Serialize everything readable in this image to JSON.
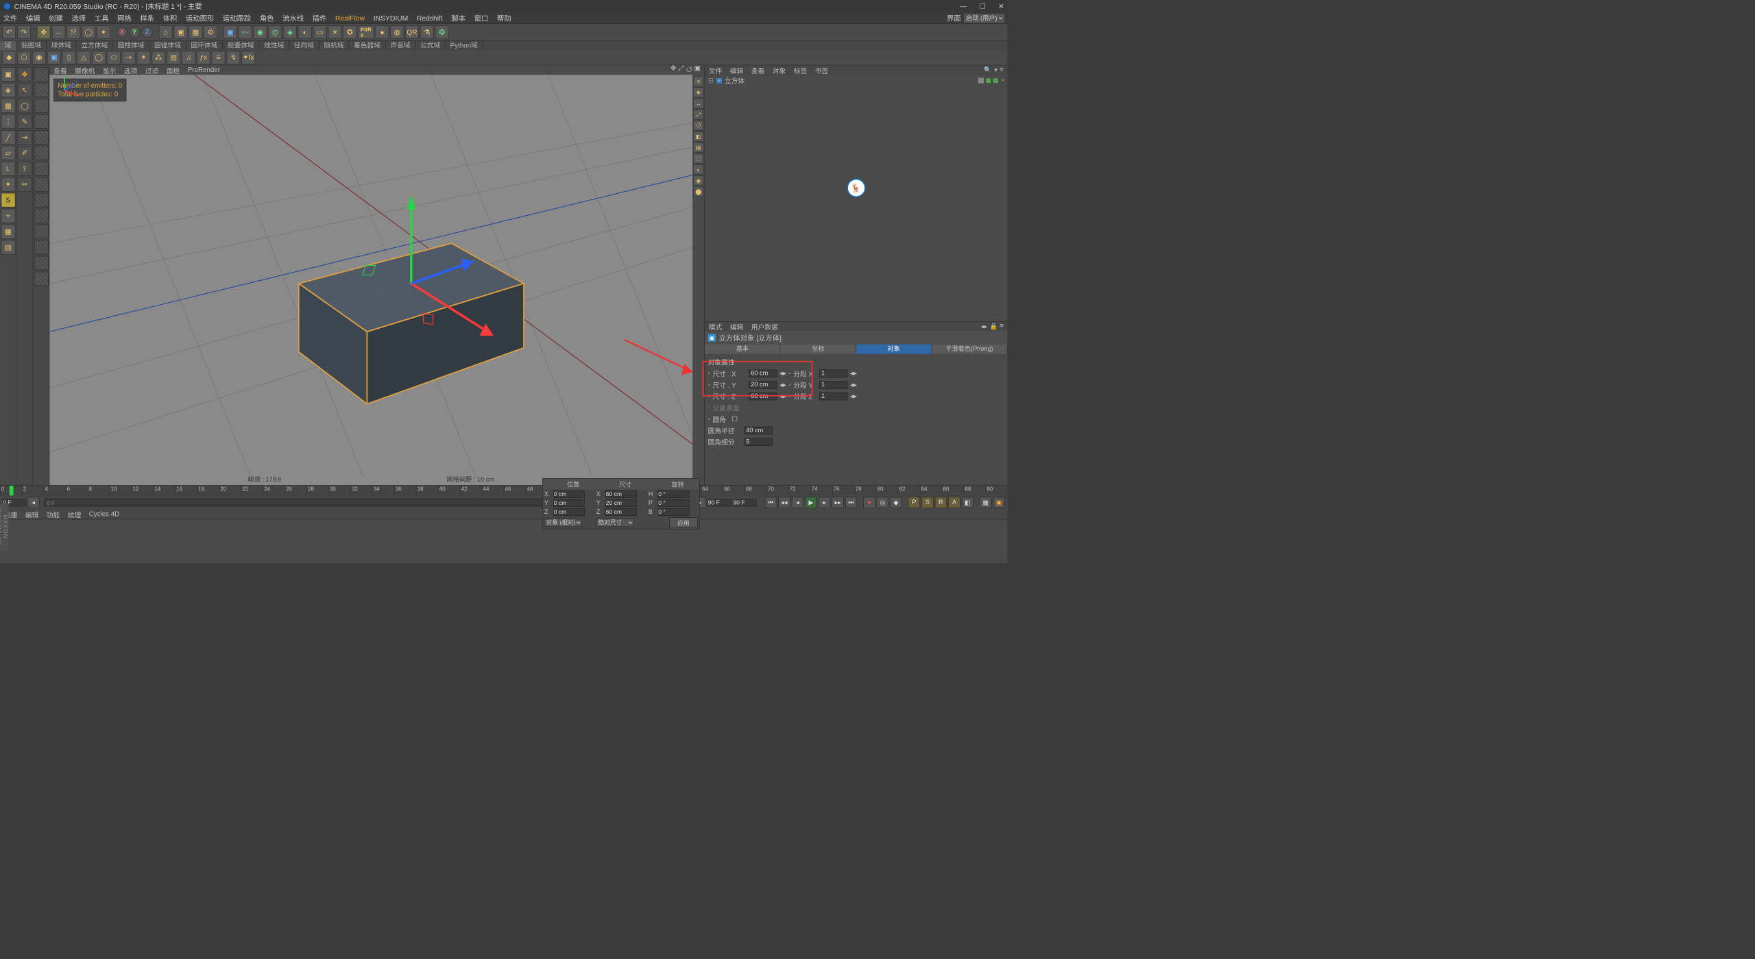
{
  "window": {
    "title": "CINEMA 4D R20.059 Studio (RC - R20) - [未标题 1 *] - 主要"
  },
  "mainmenu": {
    "items": [
      "文件",
      "编辑",
      "创建",
      "选择",
      "工具",
      "网格",
      "样条",
      "体积",
      "运动图形",
      "运动跟踪",
      "角色",
      "流水线",
      "插件",
      "RealFlow",
      "INSYDIUM",
      "Redshift",
      "脚本",
      "窗口",
      "帮助"
    ],
    "hl_idx": 13,
    "layout_lbl": "界面",
    "layout_val": "启动 (用户)"
  },
  "tabstrip": {
    "tabs": [
      "域",
      "贴图域",
      "球体域",
      "立方体域",
      "圆柱体域",
      "圆锥体域",
      "圆环体域",
      "胶囊体域",
      "线性域",
      "径向域",
      "随机域",
      "着色器域",
      "声音域",
      "公式域",
      "Python域"
    ]
  },
  "vpmenu": {
    "items": [
      "查看",
      "摄像机",
      "显示",
      "选项",
      "过滤",
      "面板",
      "ProRender"
    ]
  },
  "hud": {
    "emitters": "Number of emitters: 0",
    "particles": "Total live particles: 0"
  },
  "vpstatus": {
    "fps_lbl": "帧速",
    "fps": "178.6",
    "grid_lbl": "网格间距",
    "grid": "10 cm"
  },
  "objPanel": {
    "menu": [
      "文件",
      "编辑",
      "查看",
      "对象",
      "标签",
      "书签"
    ],
    "item": {
      "name": "立方体",
      "visA": "#5aa34d",
      "visB": "#5aa34d"
    }
  },
  "attrPanel": {
    "menu": [
      "模式",
      "编辑",
      "用户数据"
    ],
    "obj_title": "立方体对象 [立方体]",
    "tabs": [
      "基本",
      "坐标",
      "对象",
      "平滑着色(Phong)"
    ],
    "active_tab": 2,
    "group": "对象属性",
    "rows": [
      {
        "lbl": "尺寸 . X",
        "val": "60 cm",
        "lbl2": "分段 X",
        "val2": "1"
      },
      {
        "lbl": "尺寸 . Y",
        "val": "20 cm",
        "lbl2": "分段 Y",
        "val2": "1"
      },
      {
        "lbl": "尺寸 . Z",
        "val": "60 cm",
        "lbl2": "分段 Z",
        "val2": "1"
      }
    ],
    "sep_line": "分离表面",
    "fillet_chk": "圆角",
    "fillet_r": {
      "lbl": "圆角半径",
      "val": "40 cm"
    },
    "fillet_s": {
      "lbl": "圆角细分",
      "val": "5"
    }
  },
  "timeline": {
    "start": 0,
    "end": 90,
    "step": 2
  },
  "transport": {
    "cur": "0 F",
    "start": "0 F",
    "endVisible": "90 F",
    "end": "90 F"
  },
  "bottomTabs": {
    "items": [
      "创建",
      "编辑",
      "功能",
      "纹理",
      "Cycles 4D"
    ]
  },
  "coord": {
    "headers": [
      "位置",
      "尺寸",
      "旋转"
    ],
    "rows": [
      {
        "axis": "X",
        "p": "0 cm",
        "s": "60 cm",
        "r": "0 °"
      },
      {
        "axis": "Y",
        "p": "0 cm",
        "s": "20 cm",
        "r": "0 °"
      },
      {
        "axis": "Z",
        "p": "0 cm",
        "s": "60 cm",
        "r": "0 °"
      }
    ],
    "mode1": "对象 (相对)",
    "mode2": "绝对尺寸",
    "apply": "应用"
  },
  "leftstrip": "MAXON CINEMA 4D"
}
